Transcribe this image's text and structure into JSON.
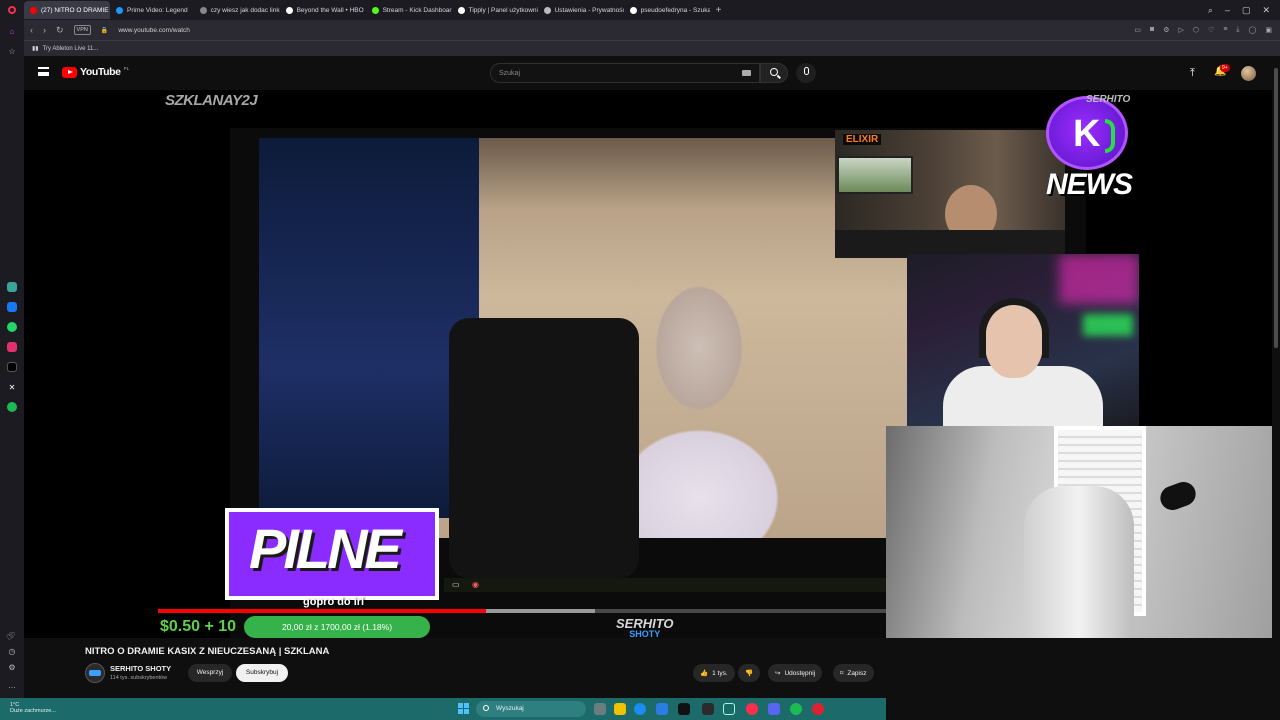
{
  "browser": {
    "tabs": [
      {
        "label": "(27) NITRO O DRAMIE K/",
        "active": true,
        "color": "#ff0000"
      },
      {
        "label": "Prime Video: Legend",
        "active": false,
        "color": "#1a98ff"
      },
      {
        "label": "czy wiesz jak dodac link z",
        "active": false,
        "color": "#888888"
      },
      {
        "label": "Beyond the Wall • HBO M",
        "active": false,
        "color": "#ffffff"
      },
      {
        "label": "Stream - Kick Dashboard",
        "active": false,
        "color": "#53fc18"
      },
      {
        "label": "Tipply | Panel użytkownika",
        "active": false,
        "color": "#ffffff"
      },
      {
        "label": "Ustawienia - Prywatność",
        "active": false,
        "color": "#bbbbbb"
      },
      {
        "label": "pseudoefedryna - Szukaj",
        "active": false,
        "color": "#ffffff"
      }
    ],
    "new_tab": "+",
    "url": "www.youtube.com/watch",
    "vpn_label": "VPN",
    "bookmark": "Try Ableton Live 11..."
  },
  "youtube": {
    "logo_text": "YouTube",
    "region": "PL",
    "search_placeholder": "Szukaj",
    "notifications_badge": "9+"
  },
  "video": {
    "watermark": "SZKLANAY2J",
    "cam_tag": "ELIXIR",
    "news_logo_text": "NEWS",
    "news_logo_letter": "K",
    "serhito_top": "SERHITO",
    "pilne": "PILNE",
    "caption": "gopro do irl",
    "donation_amount": "$0.50 + 10",
    "donation_goal": "20,00 zł z 1700,00 zł (1.18%)",
    "serhito_brand": "SERHITO",
    "shoty": "SHOTY",
    "progress_played": 0.45,
    "progress_buffered": 0.49,
    "title": "NITRO O DRAMIE KASIX Z NIEUCZESANĄ | SZKLANA"
  },
  "channel": {
    "name": "SERHITO SHOTY",
    "subscribers": "114 tys. subskrybentów",
    "support_label": "Wesprzyj",
    "subscribe_label": "Subskrybuj"
  },
  "actions": {
    "likes": "1 tys.",
    "share": "Udostępnij",
    "save": "Zapisz"
  },
  "taskbar": {
    "weather_temp": "1°C",
    "weather_desc": "Duże zachmurze...",
    "search_label": "Wyszukaj"
  }
}
